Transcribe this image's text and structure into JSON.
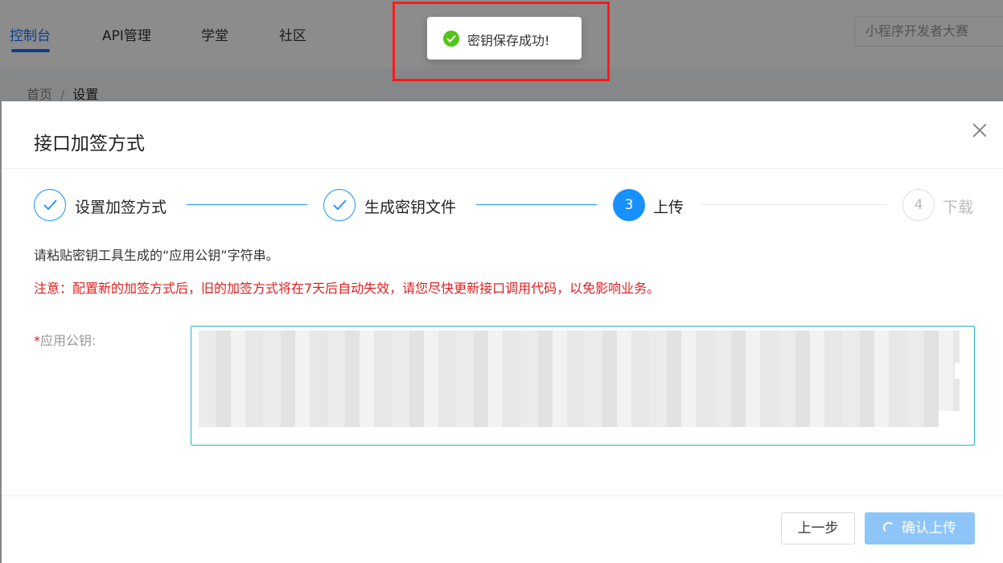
{
  "nav": {
    "items": [
      {
        "label": "控制台",
        "active": true
      },
      {
        "label": "API管理",
        "active": false
      },
      {
        "label": "学堂",
        "active": false
      },
      {
        "label": "社区",
        "active": false
      }
    ],
    "search_text": "小程序开发者大赛"
  },
  "breadcrumb": {
    "home": "首页",
    "separator": "/",
    "current": "设置"
  },
  "modal": {
    "title": "接口加签方式",
    "close_icon": "close-icon",
    "steps": [
      {
        "label": "设置加签方式",
        "status": "done"
      },
      {
        "label": "生成密钥文件",
        "status": "done"
      },
      {
        "number": "3",
        "label": "上传",
        "status": "active"
      },
      {
        "number": "4",
        "label": "下载",
        "status": "wait"
      }
    ],
    "hint": "请粘贴密钥工具生成的“应用公钥”字符串。",
    "warning": "注意：配置新的加签方式后，旧的加签方式将在7天后自动失效，请您尽快更新接口调用代码，以免影响业务。",
    "field": {
      "required_mark": "*",
      "label": "应用公钥:"
    },
    "buttons": {
      "prev": "上一步",
      "confirm": "确认上传"
    }
  },
  "toast": {
    "icon": "check-circle-icon",
    "message": "密钥保存成功!"
  },
  "colors": {
    "primary": "#1890ff",
    "nav_active": "#1677ff",
    "warning_text": "#e02020",
    "success": "#52c41a",
    "confirm_disabled": "#8ec5f8",
    "highlight_border": "#ff1a1a"
  }
}
